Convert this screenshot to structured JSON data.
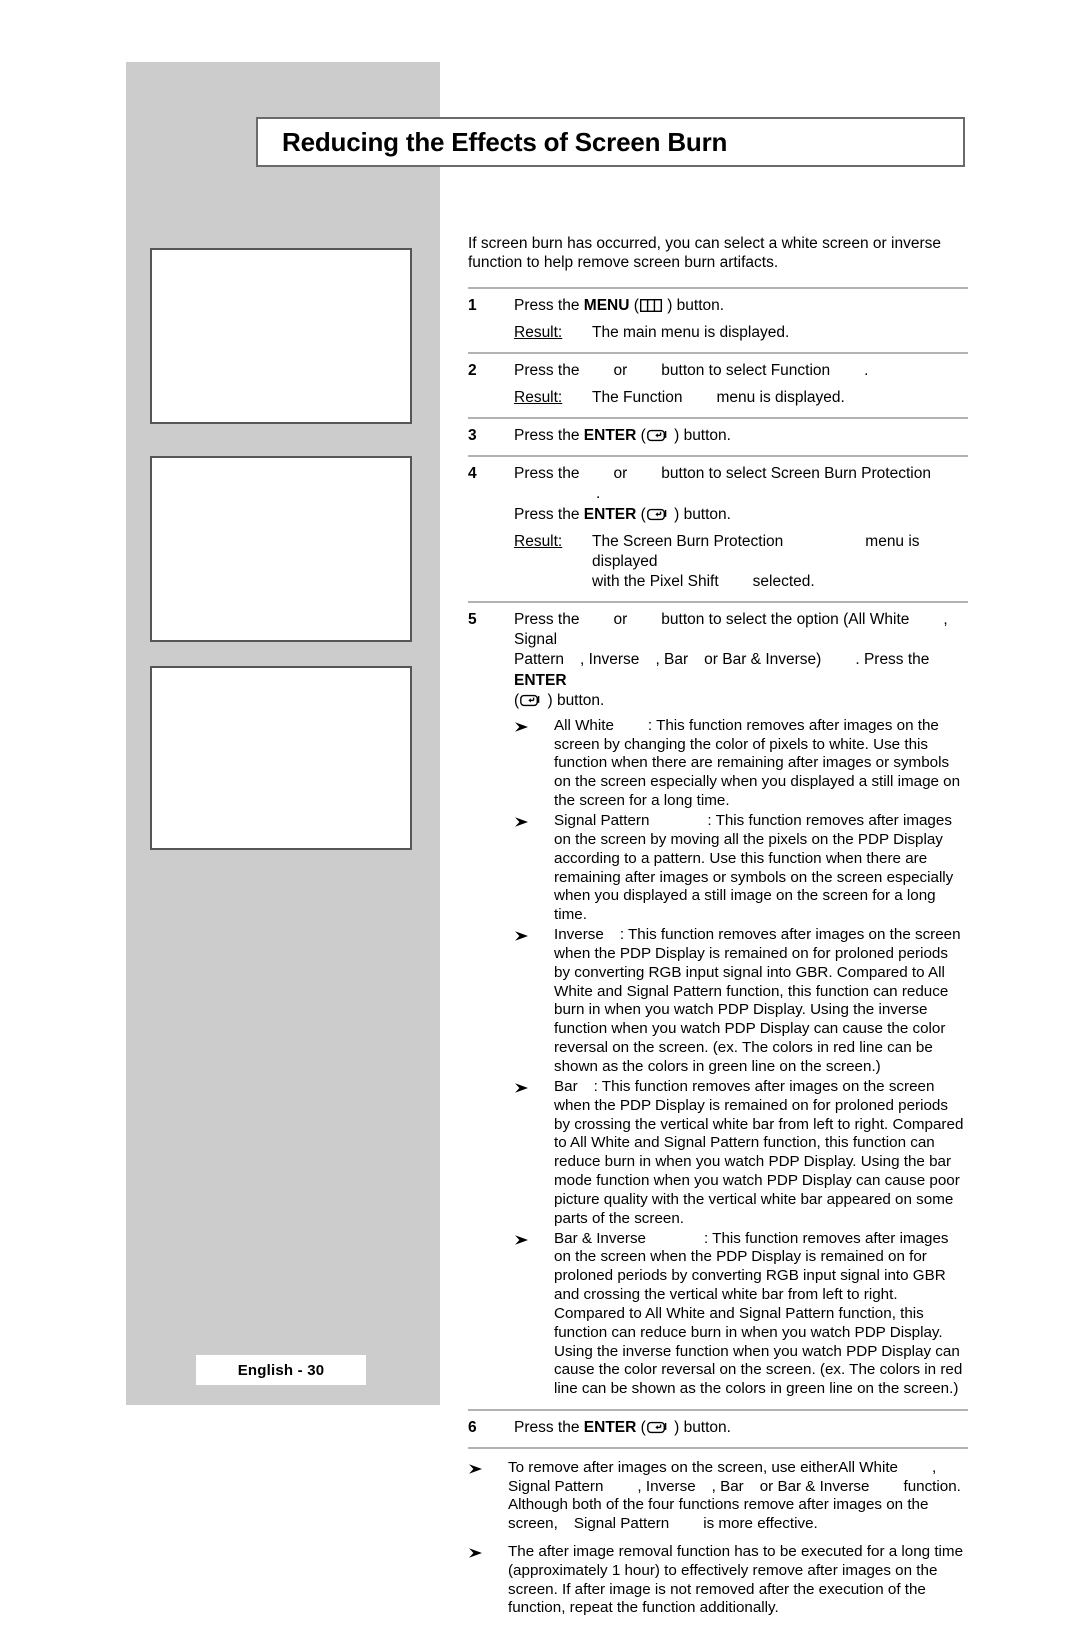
{
  "page": {
    "title": "Reducing the Effects of Screen Burn",
    "footer_label": "English - 30",
    "intro": "If screen burn has occurred, you can select a white screen or inverse function to help remove screen burn artifacts."
  },
  "icons": {
    "menu": "menu-button-icon",
    "enter": "enter-button-icon",
    "bullet": "arrow-bullet-icon"
  },
  "labels": {
    "result": "Result:",
    "press_the": "Press the",
    "or": "or",
    "button_period": "button.",
    "button_to_select": "button to select",
    "menu_bold": "MENU",
    "enter_bold": "ENTER"
  },
  "steps": [
    {
      "num": "1",
      "line_pre": "Press the ",
      "line_bold": "MENU",
      "line_post": " ) button.",
      "result_label": "Result:",
      "result_text": "The main menu is displayed."
    },
    {
      "num": "2",
      "text_a": "Press the",
      "text_or": "or",
      "text_b": "button to select Function",
      "text_c": ".",
      "result_label": "Result:",
      "result_pre": "The Function",
      "result_post": "menu is displayed."
    },
    {
      "num": "3",
      "line_pre": "Press the ",
      "line_bold": "ENTER",
      "line_post": " ) button."
    },
    {
      "num": "4",
      "text_a": "Press the",
      "text_or": "or",
      "text_b": "button to select Screen Burn Protection",
      "text_c": ".",
      "line2_pre": "Press the ",
      "line2_bold": "ENTER",
      "line2_post": " ) button.",
      "result_label": "Result:",
      "result_l1_pre": "The Screen Burn Protection",
      "result_l1_post": "menu is displayed",
      "result_l2_pre": "with the Pixel Shift",
      "result_l2_post": "selected."
    },
    {
      "num": "5",
      "text_a": "Press the",
      "text_or": "or",
      "text_b": "button to select the option (All White",
      "text_c": ", Signal",
      "text_d": "Pattern",
      "text_e": ", Inverse",
      "text_f": ", Bar",
      "text_g": "or Bar & Inverse)",
      "text_h": ". Press the ",
      "text_enter_bold": "ENTER",
      "text_i": " ) button."
    },
    {
      "num": "6",
      "line_pre": "Press the ",
      "line_bold": "ENTER",
      "line_post": " ) button."
    }
  ],
  "options": [
    {
      "name": "All White",
      "description": ": This function removes after images on the screen by changing the color of pixels to white. Use this function when there are remaining after images or symbols on the screen especially when you displayed a still image on the screen for a long time."
    },
    {
      "name": "Signal Pattern",
      "description": ": This function removes after images on the screen by moving all the pixels on the PDP Display according to a pattern. Use this function when there are remaining after images or symbols on the screen especially when you displayed a still image on the screen for a long time."
    },
    {
      "name": "Inverse",
      "description": ": This function removes after images on the screen when the PDP Display is remained on for proloned periods by converting RGB input signal into GBR. Compared to All White and Signal Pattern function, this function can reduce burn in when you watch PDP Display. Using the inverse function when you watch PDP Display can cause the color reversal on the screen. (ex. The colors in red line can be shown as the colors in green line on the screen.)"
    },
    {
      "name": "Bar",
      "description": ": This function removes after images on the screen when the PDP Display is remained on for proloned periods by crossing the vertical white bar from left to right. Compared to All White and Signal Pattern function, this function can reduce burn in when you watch PDP Display. Using the bar mode function when you watch PDP Display can cause poor picture quality  with the vertical white bar appeared on some parts of the screen."
    },
    {
      "name": "Bar & Inverse",
      "description": ": This function removes after images on the screen when the PDP Display is remained on for proloned periods by converting RGB input signal into GBR and crossing the vertical white bar from left to right. Compared to All White and Signal Pattern function, this function can reduce burn in when you watch PDP Display. Using the inverse function when you watch PDP Display can cause the color reversal on the screen. (ex. The colors in red line can be shown as the colors in green line on the screen.)"
    }
  ],
  "notes": [
    {
      "seg_a": "To remove after images on the screen, use either",
      "seg_b": "All White",
      "seg_c": ",",
      "seg_d": "Signal Pattern",
      "seg_e": ", Inverse",
      "seg_f": ", Bar",
      "seg_g": "or Bar & Inverse",
      "seg_h": "function.",
      "seg_i": "Although both of the four functions remove after images on the",
      "seg_j": "screen,",
      "seg_k": "Signal Pattern",
      "seg_l": "is more effective."
    },
    {
      "text": "The after image removal function has to be executed for a long time (approximately 1 hour) to effectively remove after images on the screen. If after image is not removed after the execution of the function, repeat the function additionally."
    }
  ]
}
